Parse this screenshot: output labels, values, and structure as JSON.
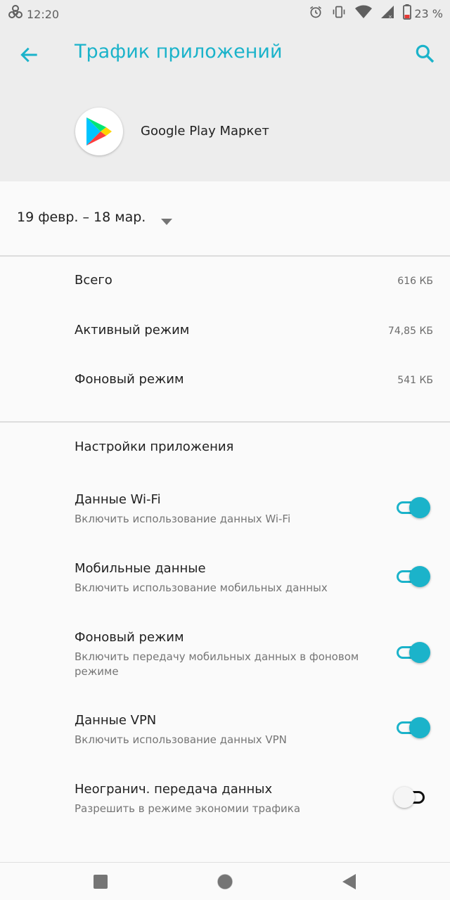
{
  "status_bar": {
    "time": "12:20",
    "battery_text": "23 %",
    "icons": [
      "biohazard-icon",
      "alarm-icon",
      "vibrate-icon",
      "wifi-icon",
      "signal-icon",
      "battery-icon"
    ]
  },
  "app_bar": {
    "title": "Трафик приложений",
    "back_icon": "arrow-back-icon",
    "search_icon": "search-icon"
  },
  "app_header": {
    "app_name": "Google Play Маркет",
    "logo_icon": "google-play-icon"
  },
  "date_range": {
    "value": "19 февр. – 18 мар."
  },
  "usage": {
    "rows": [
      {
        "label": "Всего",
        "value": "616 КБ"
      },
      {
        "label": "Активный режим",
        "value": "74,85 КБ"
      },
      {
        "label": "Фоновый режим",
        "value": "541 КБ"
      }
    ]
  },
  "settings": {
    "title": "Настройки приложения",
    "items": [
      {
        "title": "Данные Wi-Fi",
        "subtitle": "Включить использование данных Wi-Fi",
        "enabled": true
      },
      {
        "title": "Мобильные данные",
        "subtitle": "Включить использование мобильных данных",
        "enabled": true
      },
      {
        "title": "Фоновый режим",
        "subtitle": "Включить передачу мобильных данных в фоновом режиме",
        "enabled": true
      },
      {
        "title": "Данные VPN",
        "subtitle": "Включить использование данных VPN",
        "enabled": true
      },
      {
        "title": "Неогранич. передача данных",
        "subtitle": "Разрешить в режиме экономии трафика",
        "enabled": false
      }
    ]
  },
  "colors": {
    "accent": "#1bb3ca",
    "header_bg": "#ededed",
    "page_bg": "#fafafa"
  },
  "nav_bar": {
    "icons": [
      "recents-icon",
      "home-icon",
      "back-icon"
    ]
  }
}
